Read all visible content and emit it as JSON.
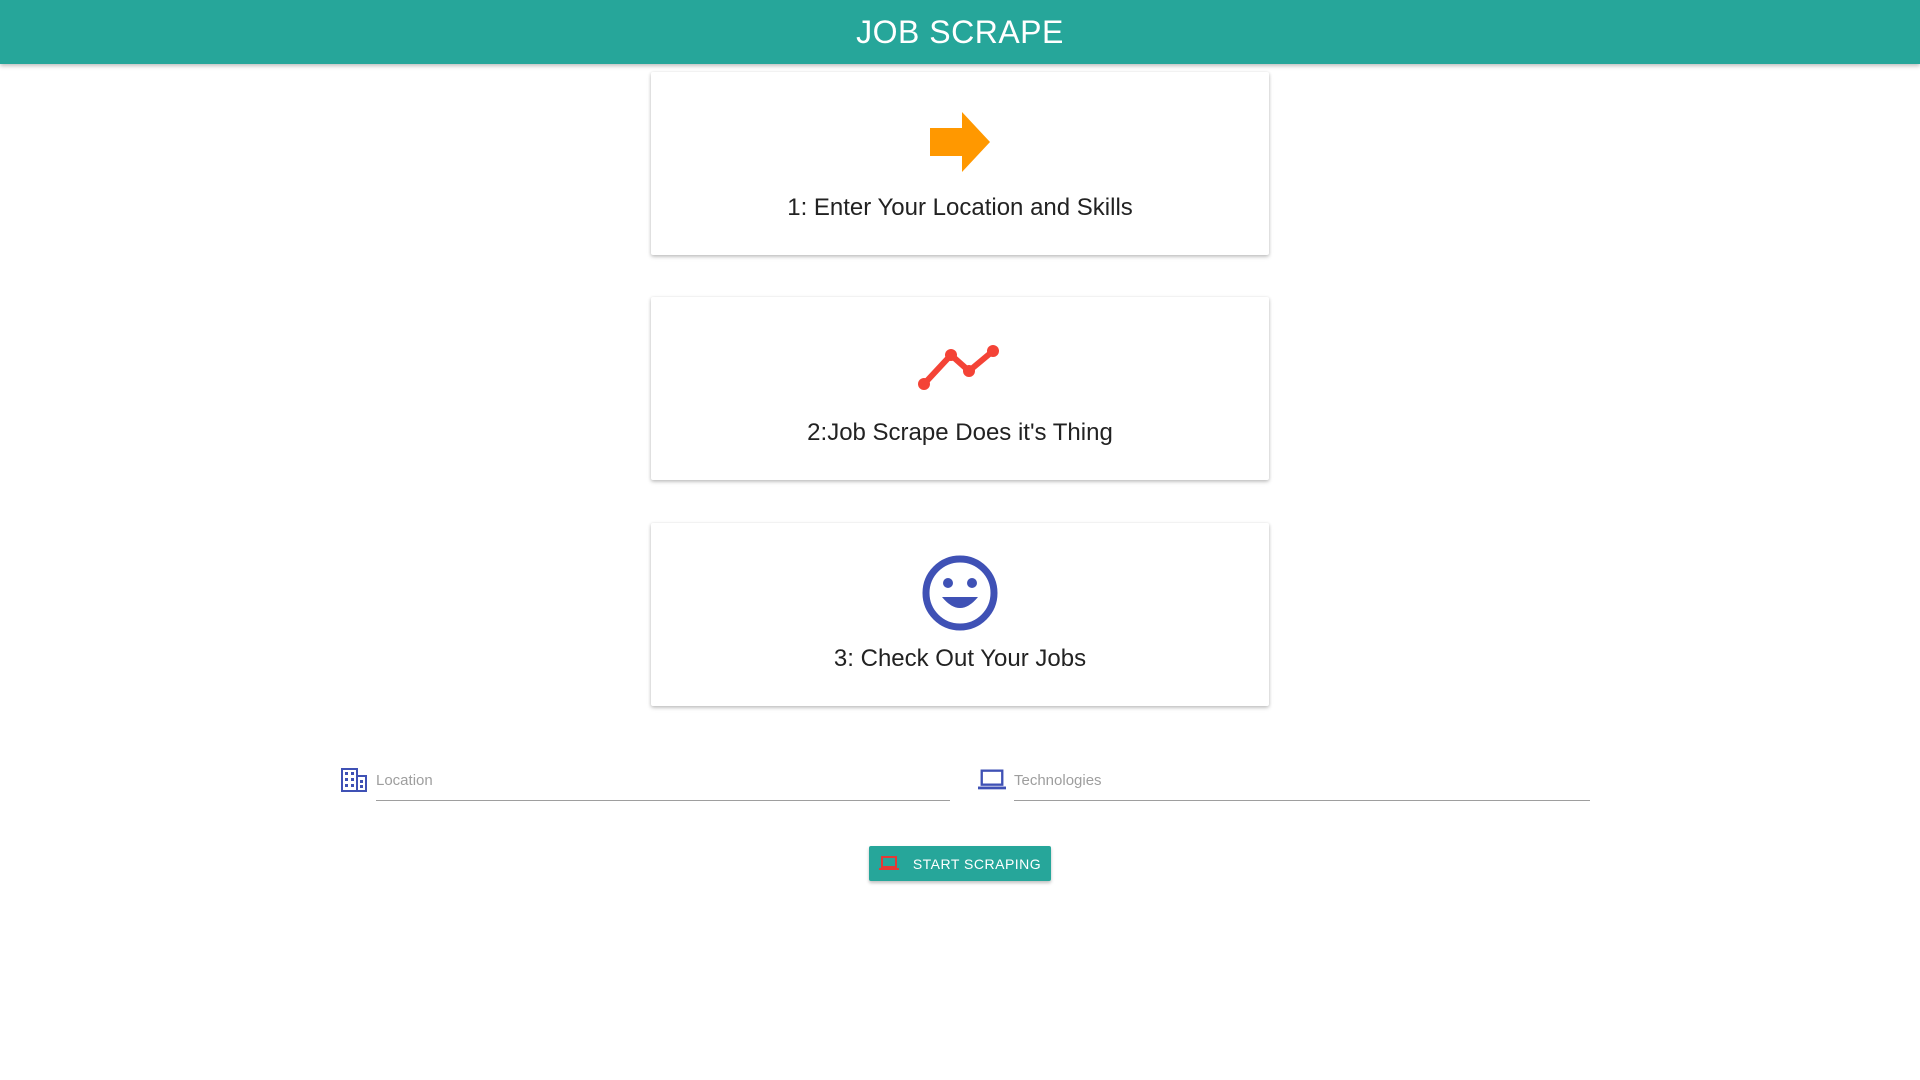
{
  "header": {
    "title": "JOB SCRAPE"
  },
  "steps": [
    {
      "label": "1: Enter Your Location and Skills",
      "icon": "arrow-forward-icon",
      "icon_color": "#ff9800"
    },
    {
      "label": "2:Job Scrape Does it's Thing",
      "icon": "trending-line-icon",
      "icon_color": "#f44336"
    },
    {
      "label": "3: Check Out Your Jobs",
      "icon": "smiley-face-icon",
      "icon_color": "#3f51b5"
    }
  ],
  "form": {
    "location": {
      "placeholder": "Location",
      "value": "",
      "icon": "building-icon",
      "icon_color": "#3f51b5"
    },
    "technologies": {
      "placeholder": "Technologies",
      "value": "",
      "icon": "laptop-icon",
      "icon_color": "#3f51b5"
    },
    "submit": {
      "label": "START SCRAPING",
      "icon": "laptop-icon",
      "icon_color": "#e53935"
    }
  },
  "colors": {
    "primary": "#26a69a",
    "accent_orange": "#ff9800",
    "accent_red": "#f44336",
    "accent_indigo": "#3f51b5"
  }
}
